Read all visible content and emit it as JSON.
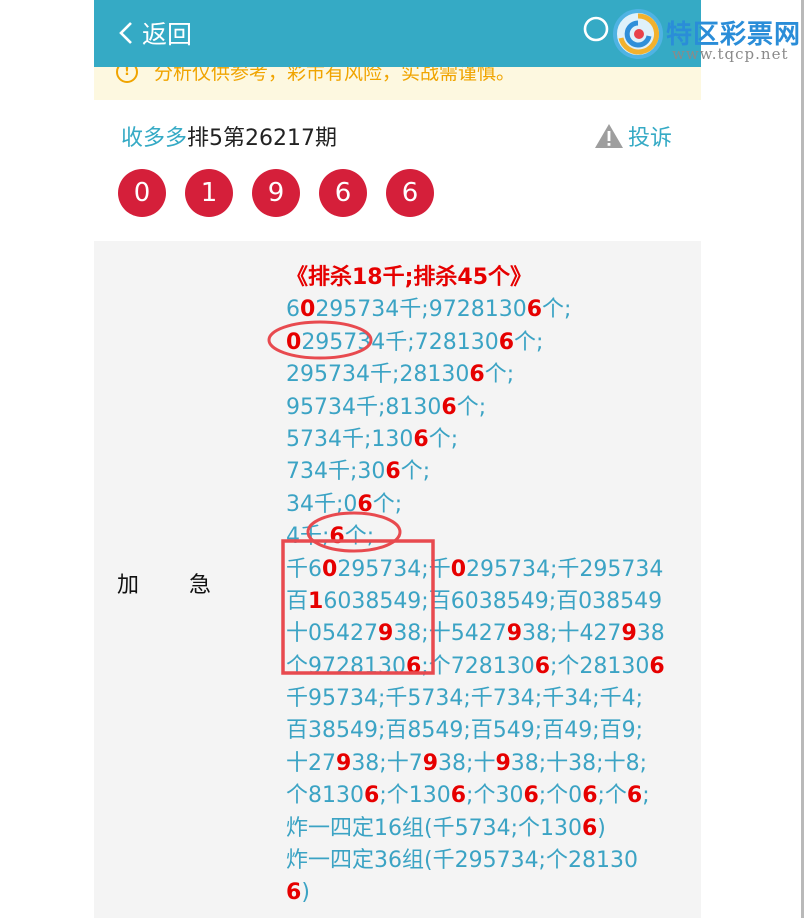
{
  "header": {
    "back_label": "返回",
    "logo_title": "特区彩票网",
    "logo_url": "www.tqcp.net"
  },
  "notice": {
    "text": "分析仅供参考，彩市有风险，实战需谨慎。"
  },
  "post": {
    "author": "收多多",
    "issue": "排5第26217期",
    "report_label": "投诉"
  },
  "balls": [
    "0",
    "1",
    "9",
    "6",
    "6"
  ],
  "panel": {
    "label": "加　　急",
    "lines": [
      [
        {
          "t": "《排杀18千;排杀45个》",
          "h": true
        }
      ],
      [
        {
          "t": "6"
        },
        {
          "t": "0",
          "h": true
        },
        {
          "t": "295734千;9728130"
        },
        {
          "t": "6",
          "h": true
        },
        {
          "t": "个;"
        }
      ],
      [
        {
          "t": "0",
          "h": true
        },
        {
          "t": "295734千;728130"
        },
        {
          "t": "6",
          "h": true
        },
        {
          "t": "个;"
        }
      ],
      [
        {
          "t": "295734千;28130"
        },
        {
          "t": "6",
          "h": true
        },
        {
          "t": "个;"
        }
      ],
      [
        {
          "t": "95734千;8130"
        },
        {
          "t": "6",
          "h": true
        },
        {
          "t": "个;"
        }
      ],
      [
        {
          "t": "5734千;130"
        },
        {
          "t": "6",
          "h": true
        },
        {
          "t": "个;"
        }
      ],
      [
        {
          "t": "734千;30"
        },
        {
          "t": "6",
          "h": true
        },
        {
          "t": "个;"
        }
      ],
      [
        {
          "t": "34千;0"
        },
        {
          "t": "6",
          "h": true
        },
        {
          "t": "个;"
        }
      ],
      [
        {
          "t": "4千;"
        },
        {
          "t": "6",
          "h": true
        },
        {
          "t": "个;"
        }
      ],
      [
        {
          "t": "千6"
        },
        {
          "t": "0",
          "h": true
        },
        {
          "t": "295734;千"
        },
        {
          "t": "0",
          "h": true
        },
        {
          "t": "295734;千295734"
        }
      ],
      [
        {
          "t": "百"
        },
        {
          "t": "1",
          "h": true
        },
        {
          "t": "6038549;百6038549;百038549"
        }
      ],
      [
        {
          "t": "十05427"
        },
        {
          "t": "9",
          "h": true
        },
        {
          "t": "38;十5427"
        },
        {
          "t": "9",
          "h": true
        },
        {
          "t": "38;十427"
        },
        {
          "t": "9",
          "h": true
        },
        {
          "t": "38"
        }
      ],
      [
        {
          "t": "个9728130"
        },
        {
          "t": "6",
          "h": true
        },
        {
          "t": ";个728130"
        },
        {
          "t": "6",
          "h": true
        },
        {
          "t": ";个28130"
        },
        {
          "t": "6",
          "h": true
        }
      ],
      [
        {
          "t": "千95734;千5734;千734;千34;千4;"
        }
      ],
      [
        {
          "t": "百38549;百8549;百549;百49;百9;"
        }
      ],
      [
        {
          "t": "十27"
        },
        {
          "t": "9",
          "h": true
        },
        {
          "t": "38;十7"
        },
        {
          "t": "9",
          "h": true
        },
        {
          "t": "38;十"
        },
        {
          "t": "9",
          "h": true
        },
        {
          "t": "38;十38;十8;"
        }
      ],
      [
        {
          "t": "个8130"
        },
        {
          "t": "6",
          "h": true
        },
        {
          "t": ";个130"
        },
        {
          "t": "6",
          "h": true
        },
        {
          "t": ";个30"
        },
        {
          "t": "6",
          "h": true
        },
        {
          "t": ";个0"
        },
        {
          "t": "6",
          "h": true
        },
        {
          "t": ";个"
        },
        {
          "t": "6",
          "h": true
        },
        {
          "t": ";"
        }
      ],
      [
        {
          "t": "炸一四定16组(千5734;个130"
        },
        {
          "t": "6",
          "h": true
        },
        {
          "t": ")"
        }
      ],
      [
        {
          "t": "炸一四定36组(千295734;个28130"
        }
      ],
      [
        {
          "t": "6",
          "h": true
        },
        {
          "t": ")"
        }
      ]
    ]
  },
  "colors": {
    "brand": "#35aac5",
    "highlight": "#e60000",
    "ball": "#d51f3a",
    "annotation": "#e84a4f"
  }
}
